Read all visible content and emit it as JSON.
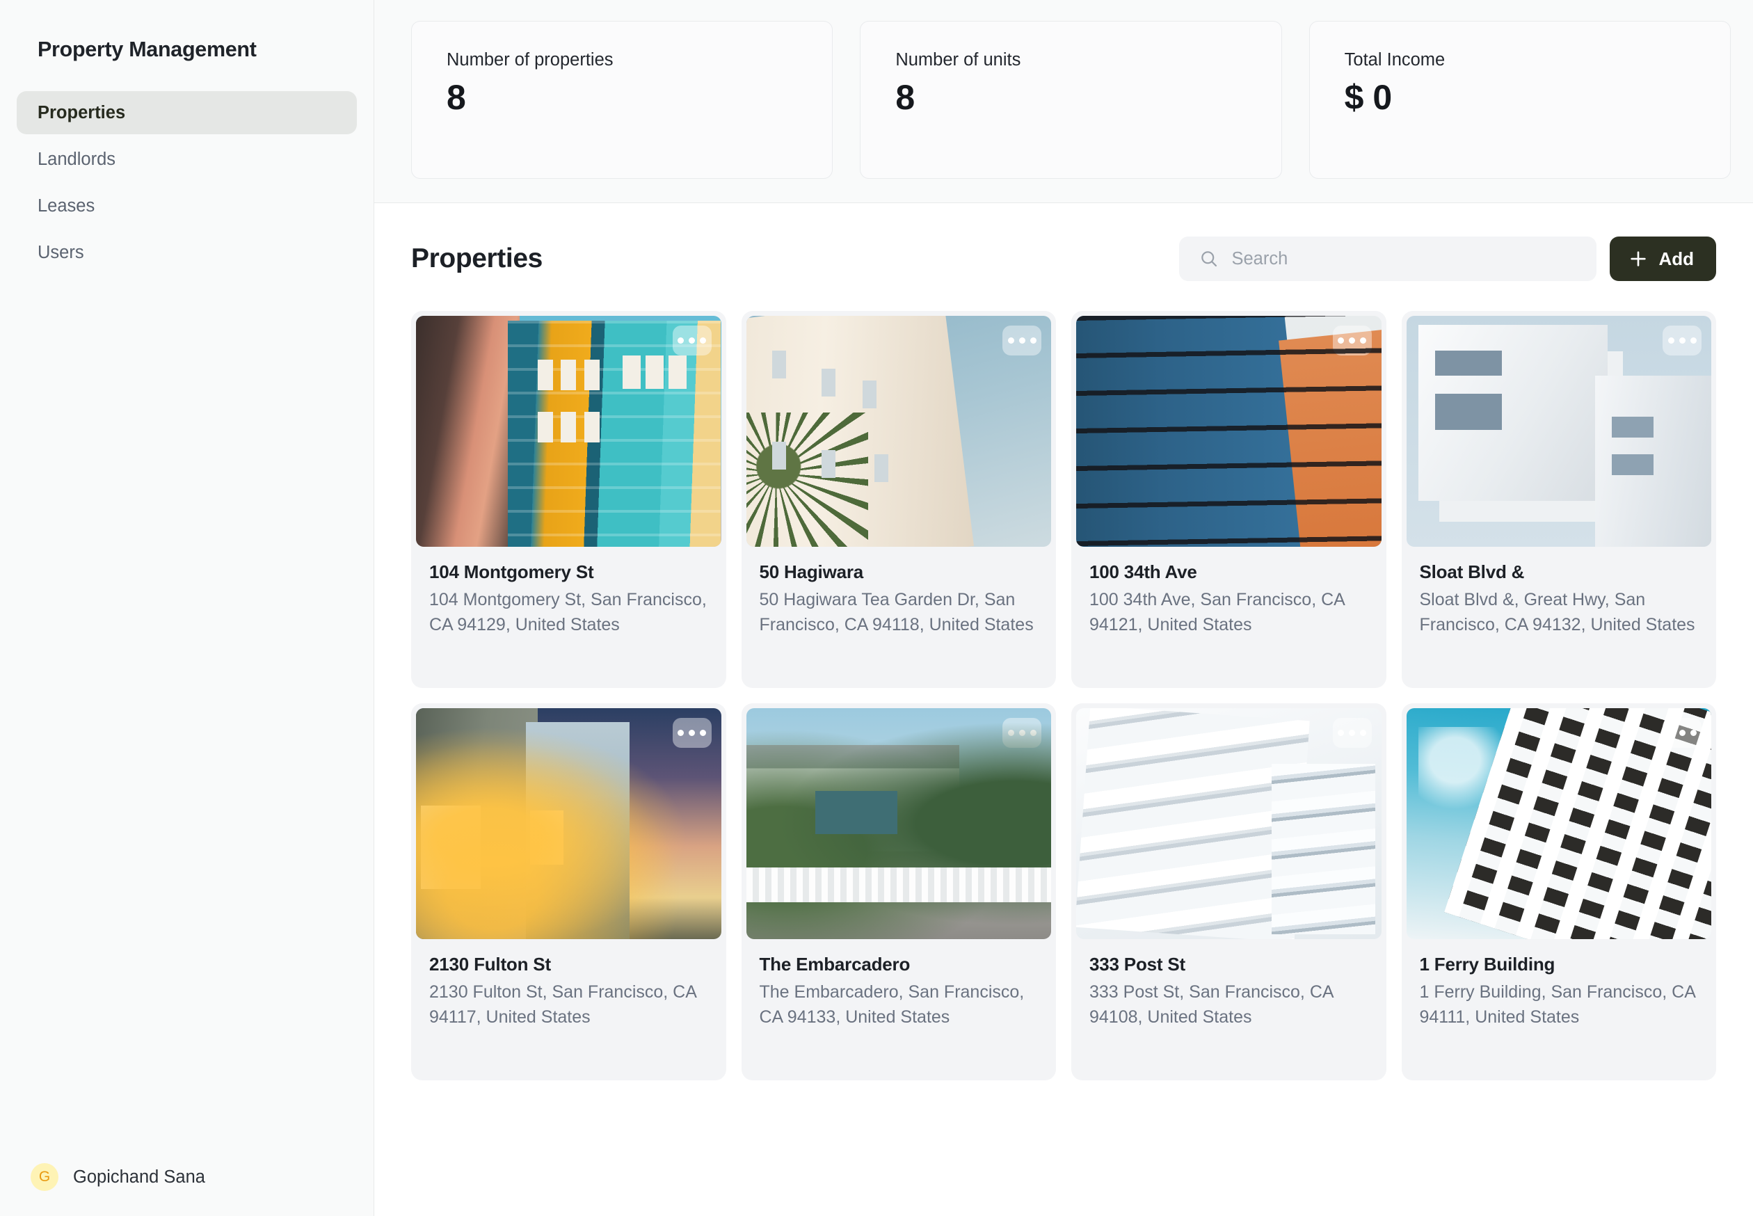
{
  "sidebar": {
    "brand": "Property Management",
    "items": [
      {
        "label": "Properties",
        "active": true
      },
      {
        "label": "Landlords",
        "active": false
      },
      {
        "label": "Leases",
        "active": false
      },
      {
        "label": "Users",
        "active": false
      }
    ],
    "user": {
      "initial": "G",
      "name": "Gopichand Sana",
      "avatar_bg": "#fef3b5",
      "avatar_fg": "#e99a12"
    }
  },
  "stats": [
    {
      "label": "Number of properties",
      "value": "8"
    },
    {
      "label": "Number of units",
      "value": "8"
    },
    {
      "label": "Total Income",
      "value": "$ 0"
    }
  ],
  "content": {
    "title": "Properties",
    "search": {
      "placeholder": "Search",
      "value": "",
      "icon": "search-icon"
    },
    "add_button": {
      "label": "Add",
      "icon": "plus-icon",
      "bg": "#2c3022",
      "fg": "#ffffff"
    },
    "menu_icon": "more-options-icon"
  },
  "properties": [
    {
      "title": "104 Montgomery St",
      "address": "104 Montgomery St, San Francisco, CA 94129, United States",
      "photo": "colorful-row-houses"
    },
    {
      "title": "50 Hagiwara",
      "address": "50 Hagiwara Tea Garden Dr, San Francisco, CA 94118, United States",
      "photo": "cream-deco-building-palm"
    },
    {
      "title": "100 34th Ave",
      "address": "100 34th Ave, San Francisco, CA 94121, United States",
      "photo": "blue-orange-balconies"
    },
    {
      "title": "Sloat Blvd &",
      "address": "Sloat Blvd &, Great Hwy, San Francisco, CA 94132, United States",
      "photo": "white-modern-block"
    },
    {
      "title": "2130 Fulton St",
      "address": "2130 Fulton St, San Francisco, CA 94117, United States",
      "photo": "dusk-house-lit-entry"
    },
    {
      "title": "The Embarcadero",
      "address": "The Embarcadero, San Francisco, CA 94133, United States",
      "photo": "blue-cottage-picket-fence"
    },
    {
      "title": "333 Post St",
      "address": "333 Post St, San Francisco, CA 94108, United States",
      "photo": "white-stacked-tower"
    },
    {
      "title": "1 Ferry Building",
      "address": "1 Ferry Building, San Francisco, CA 94111, United States",
      "photo": "white-grid-facade-sky"
    }
  ],
  "theme": {
    "sidebar_bg": "#f9fafa",
    "header_bg": "#f9fafa",
    "card_bg": "#f3f4f6",
    "accent_dark": "#2c3022",
    "text_primary": "#1c2026",
    "text_muted": "#6a7280"
  }
}
